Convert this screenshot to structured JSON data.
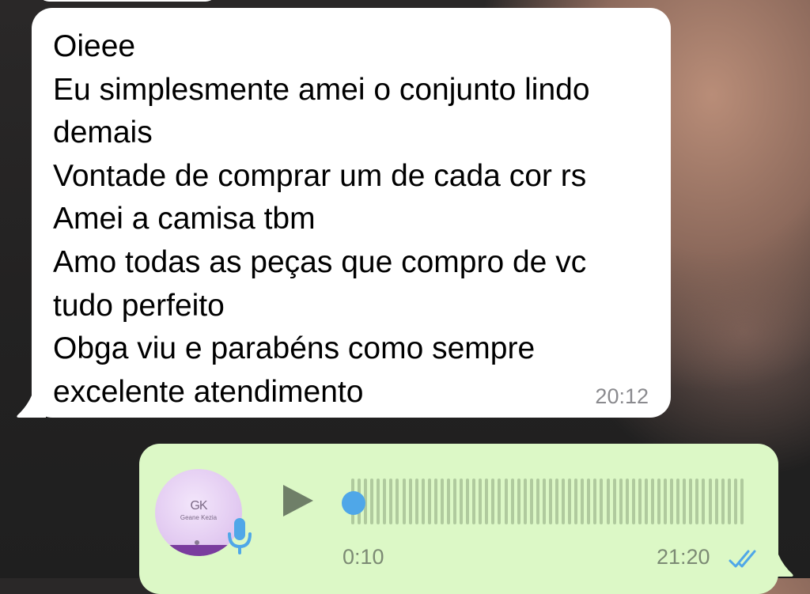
{
  "incoming_message": {
    "lines": [
      "Oieee",
      "Eu simplesmente amei o conjunto lindo",
      "demais",
      "Vontade de comprar um de cada cor rs",
      "Amei a camisa tbm",
      "Amo todas as peças que compro de vc",
      "tudo perfeito",
      "Obga viu e  parabéns como sempre",
      "excelente atendimento"
    ],
    "time": "20:12"
  },
  "voice_message": {
    "avatar": {
      "logo_mark": "GK",
      "logo_text": "Geane Kezia"
    },
    "duration": "0:10",
    "time": "21:20",
    "status_icon": "double-check-read-icon",
    "mic_icon": "microphone-icon",
    "play_icon": "play-icon",
    "progress": 0
  },
  "colors": {
    "incoming_bubble": "#ffffff",
    "outgoing_bubble": "#dcf8c6",
    "read_ticks": "#4fa7e8",
    "scrubber": "#4fa7e8",
    "timestamp": "#8a8a8e"
  }
}
